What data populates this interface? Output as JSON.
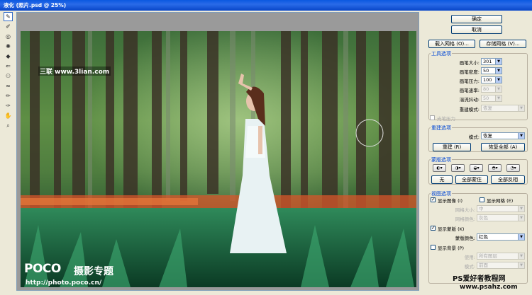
{
  "window": {
    "title": "液化 (照片.psd @ 25%)"
  },
  "tools": [
    {
      "name": "forward-warp-icon",
      "glyph": "✎"
    },
    {
      "name": "reconstruct-icon",
      "glyph": "✐"
    },
    {
      "name": "twirl-icon",
      "glyph": "◎"
    },
    {
      "name": "pucker-icon",
      "glyph": "✺"
    },
    {
      "name": "bloat-icon",
      "glyph": "◆"
    },
    {
      "name": "push-left-icon",
      "glyph": "⇐"
    },
    {
      "name": "mirror-icon",
      "glyph": "⚇"
    },
    {
      "name": "turbulence-icon",
      "glyph": "≈"
    },
    {
      "name": "freeze-mask-icon",
      "glyph": "✏"
    },
    {
      "name": "thaw-mask-icon",
      "glyph": "✑"
    },
    {
      "name": "hand-icon",
      "glyph": "✋"
    },
    {
      "name": "zoom-icon",
      "glyph": "⌕"
    }
  ],
  "buttons": {
    "ok": "确定",
    "cancel": "取消",
    "load_mesh": "载入网格 (O)...",
    "save_mesh": "存储网格 (V)...",
    "reconstruct": "重建 (R)",
    "restore_all": "恢复全部 (A)",
    "none": "无",
    "mask_all": "全部蒙住",
    "invert_all": "全部反相"
  },
  "tool_options": {
    "title": "工具选项",
    "brush_size_label": "画笔大小:",
    "brush_size": "301",
    "brush_density_label": "画笔密度:",
    "brush_density": "50",
    "brush_pressure_label": "画笔压力:",
    "brush_pressure": "100",
    "brush_rate_label": "画笔速率:",
    "brush_rate": "80",
    "turbulent_jitter_label": "湍流抖动:",
    "turbulent_jitter": "50",
    "reconstruct_mode_label": "重建模式:",
    "reconstruct_mode": "恢复",
    "stylus_label": "光笔压力"
  },
  "reconstruct_options": {
    "title": "重建选项",
    "mode_label": "模式:",
    "mode": "恢复"
  },
  "mask_options": {
    "title": "蒙版选项"
  },
  "view_options": {
    "title": "视图选项",
    "show_image": "显示图像 (I)",
    "show_mesh": "显示网格 (E)",
    "mesh_size_label": "网格大小:",
    "mesh_size": "中",
    "mesh_color_label": "网格颜色:",
    "mesh_color": "灰色",
    "show_mask": "显示蒙版 (K)",
    "mask_color_label": "蒙版颜色:",
    "mask_color": "红色",
    "show_backdrop": "显示背景 (P)",
    "use_label": "使用:",
    "use": "所有图层",
    "mode_label": "模式:",
    "mode": "前面"
  },
  "watermarks": {
    "site_top": "三联 www.3lian.com",
    "poco": "POCO",
    "poco_sub": "摄影专题",
    "poco_url": "http://photo.poco.cn/",
    "ps_fans": "PS爱好者教程网",
    "ps_url": "www.psahz.com"
  },
  "colors": {
    "accent": "#0046d5",
    "title_bar": "#0a58e0"
  }
}
